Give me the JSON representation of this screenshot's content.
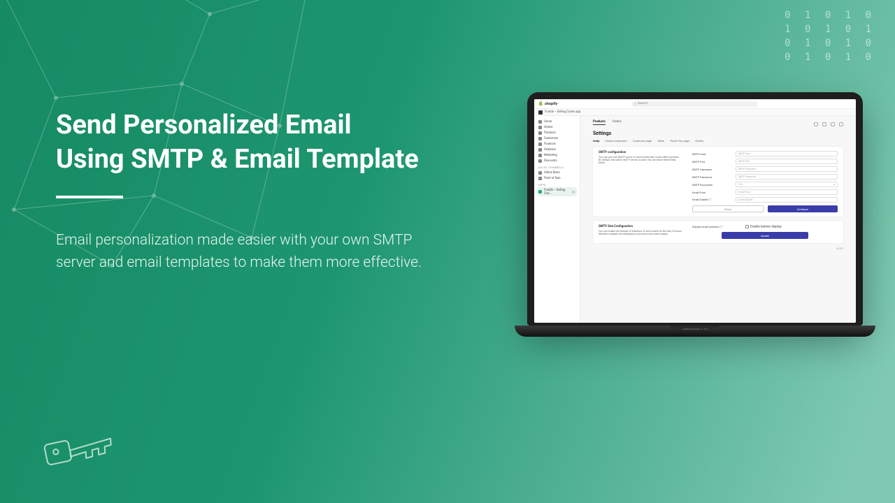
{
  "binary": "0 1 0 1 0\n1 0 1 0 1\n0 1 0 1 0\n0 1 0 1 0",
  "hero": {
    "title_line1": "Send Personalized Email",
    "title_line2": "Using SMTP & Email Template",
    "subtitle": "Email personalization made easier with your own SMTP server and email templates to make them more effective."
  },
  "laptop_label": "MacBook Pro",
  "shopify": {
    "brand": "shopify",
    "search_placeholder": "Search",
    "breadcrumb": "Fordde – Selling Codes app",
    "sidebar": {
      "items": [
        "Home",
        "Orders",
        "Products",
        "Customers",
        "Finances",
        "Analytics",
        "Marketing",
        "Discounts"
      ],
      "channels_label": "Sales channels",
      "channels": [
        "Online Store",
        "Point of Sale"
      ],
      "apps_label": "Apps",
      "app_item": "Fordde – Selling Cod…",
      "app_badge": "1"
    },
    "app_tabs": [
      "Products",
      "Orders"
    ],
    "page_title": "Settings",
    "settings_tabs": [
      "Smtp",
      "Email constructor",
      "Customer page",
      "Table",
      "Thank You page",
      "Orders"
    ],
    "smtp": {
      "heading": "SMTP configuration",
      "desc": "You can use your SMTP server to send emails with codes after purchase. By default, the built-in SMTP server is used. You can leave these fields blank.",
      "fields": [
        {
          "label": "SMTP Host",
          "placeholder": "SMTP Host"
        },
        {
          "label": "SMTP Port",
          "placeholder": "SMTP Port"
        },
        {
          "label": "SMTP Username",
          "placeholder": "SMTP Username"
        },
        {
          "label": "SMTP Password",
          "placeholder": "SMTP Password"
        },
        {
          "label": "SMTP Encryption",
          "placeholder": "TLS"
        },
        {
          "label": "Email From",
          "placeholder": "Email From"
        },
        {
          "label": "Email Subject ⓘ",
          "placeholder": "Email Subject"
        }
      ],
      "reset": "Reset",
      "configure": "Configure"
    },
    "stats": {
      "heading": "SMTP Stat Configuration",
      "desc": "You can enable the display of statistics of sent emails for the last 24 hours. Statistics widgets are displayed on products and orders pages.",
      "display_label": "Display email statistics ⓘ",
      "checkbox_label": "Enable banner display",
      "update": "Update"
    },
    "version": "v5.5.0"
  }
}
